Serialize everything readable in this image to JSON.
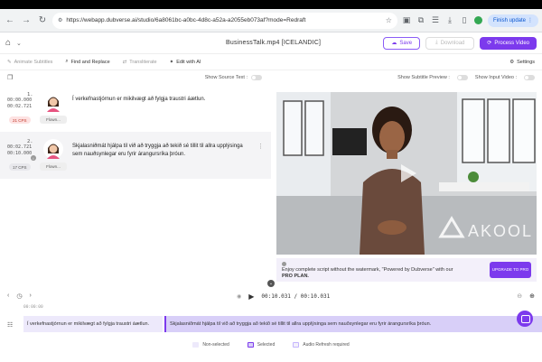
{
  "browser": {
    "url": "https://webapp.dubverse.ai/studio/6a8061bc-a0bc-4d8c-a52a-a2055eb073af?mode=Redraft",
    "finish_update": "Finish update"
  },
  "header": {
    "title": "BusinessTalk.mp4  [ICELANDIC]",
    "save": "Save",
    "download": "Download",
    "process": "Process Video"
  },
  "toolbar": {
    "items": [
      "Animate Subtitles",
      "Find and Replace",
      "Transliterate",
      "Edit with AI"
    ],
    "settings": "Settings"
  },
  "left_panel": {
    "show_source_text": "Show Source Text :"
  },
  "segments": [
    {
      "index": "1.",
      "start": "00:00.000",
      "end": "00:02.721",
      "cps": "21 CPS",
      "speaker": "Flown...",
      "text": "Í verkefnastjórnun er mikilvægt að fylgja traustri áætlun."
    },
    {
      "index": "2.",
      "start": "00:02.721",
      "end": "00:10.000",
      "cps": "17 CPS",
      "speaker": "Flown...",
      "text": "Skjalasniðmát hjálpa til við að tryggja að tekið sé tillit til allra upplýsinga sem nauðsynlegar eru fyrir árangursríka þróun."
    }
  ],
  "right_panel": {
    "show_subtitle_preview": "Show Subtitle Preview :",
    "show_input_video": "Show Input Video :",
    "watermark": "AKOOL",
    "promo_line1": "Enjoy complete script without the watermark, \"Powered by Dubverse\" with our",
    "promo_line2": "PRO PLAN.",
    "promo_button": "UPGRADE TO PRO"
  },
  "player": {
    "time": "00:10.031 / 00:10.031"
  },
  "timeline": {
    "ruler": "00:00:00",
    "clips": [
      "Í verkefnastjórnun er mikilvægt að fylgja traustri áætlun.",
      "Skjalasniðmát hjálpa til við að tryggja að tekið sé tillit til allra upplýsinga sem nauðsynlegar eru fyrir árangursríka þróun."
    ]
  },
  "legend": {
    "non_selected": "Non-selected",
    "selected": "Selected",
    "audio_refresh": "Audio Refresh required"
  },
  "colors": {
    "accent": "#7c3aed",
    "clip_selected": "#d8cff8",
    "clip_unselected": "#ede9fb"
  }
}
